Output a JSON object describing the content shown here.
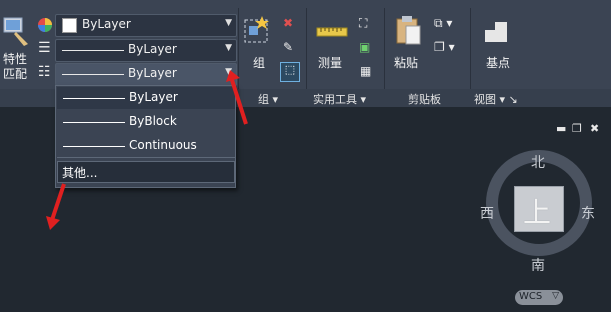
{
  "ribbon": {
    "properties_label": "特性\n匹配",
    "color_combo": {
      "value": "ByLayer"
    },
    "linetype_combo": {
      "value": "ByLayer"
    },
    "lineweight_combo": {
      "value": "ByLayer"
    },
    "group_label": "组",
    "measure_label": "测量",
    "paste_label": "粘贴",
    "basepoint_label": "基点",
    "panels": {
      "group": "组 ▾",
      "utilities": "实用工具 ▾",
      "clipboard": "剪贴板",
      "view": "视图 ▾ ↘"
    }
  },
  "dropdown": {
    "items": [
      "ByLayer",
      "ByBlock",
      "Continuous"
    ],
    "other_label": "其他..."
  },
  "viewcube": {
    "top_face": "上",
    "north": "北",
    "south": "南",
    "east": "东",
    "west": "西",
    "wcs_label": "WCS"
  },
  "colors": {
    "annotation_arrow": "#e02020",
    "ribbon_bg": "#3b4453",
    "viewport_bg": "#212830"
  }
}
